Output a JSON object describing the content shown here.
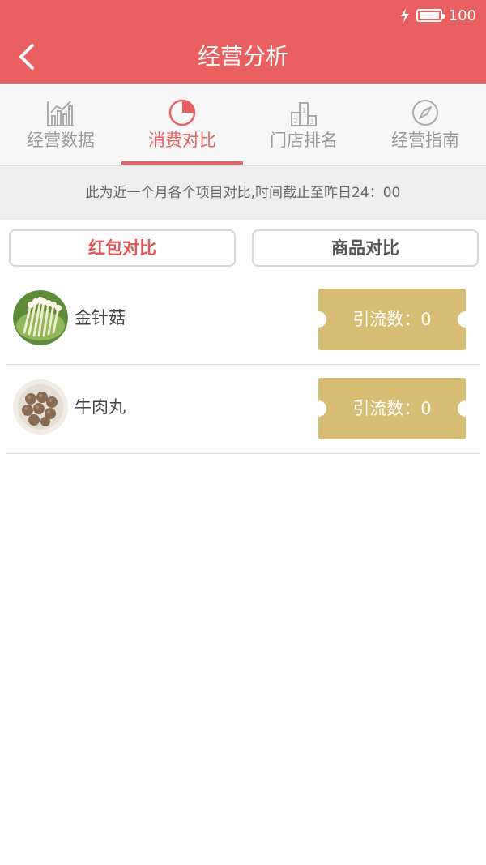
{
  "status": {
    "battery": "100"
  },
  "header": {
    "title": "经营分析"
  },
  "tabs": [
    {
      "label": "经营数据",
      "icon": "bar-chart-icon"
    },
    {
      "label": "消费对比",
      "icon": "pie-chart-icon",
      "active": true
    },
    {
      "label": "门店排名",
      "icon": "podium-icon"
    },
    {
      "label": "经营指南",
      "icon": "compass-icon"
    }
  ],
  "notice": "此为近一个月各个项目对比,时间截止至昨日24：00",
  "buttons": {
    "red_packet": "红包对比",
    "goods": "商品对比"
  },
  "items": [
    {
      "name": "金针菇",
      "badge": "引流数：0",
      "icon": "enoki-mushroom-image"
    },
    {
      "name": "牛肉丸",
      "badge": "引流数：0",
      "icon": "beef-ball-image"
    }
  ],
  "colors": {
    "primary": "#ea5f60",
    "ticket": "#d7bc73"
  }
}
